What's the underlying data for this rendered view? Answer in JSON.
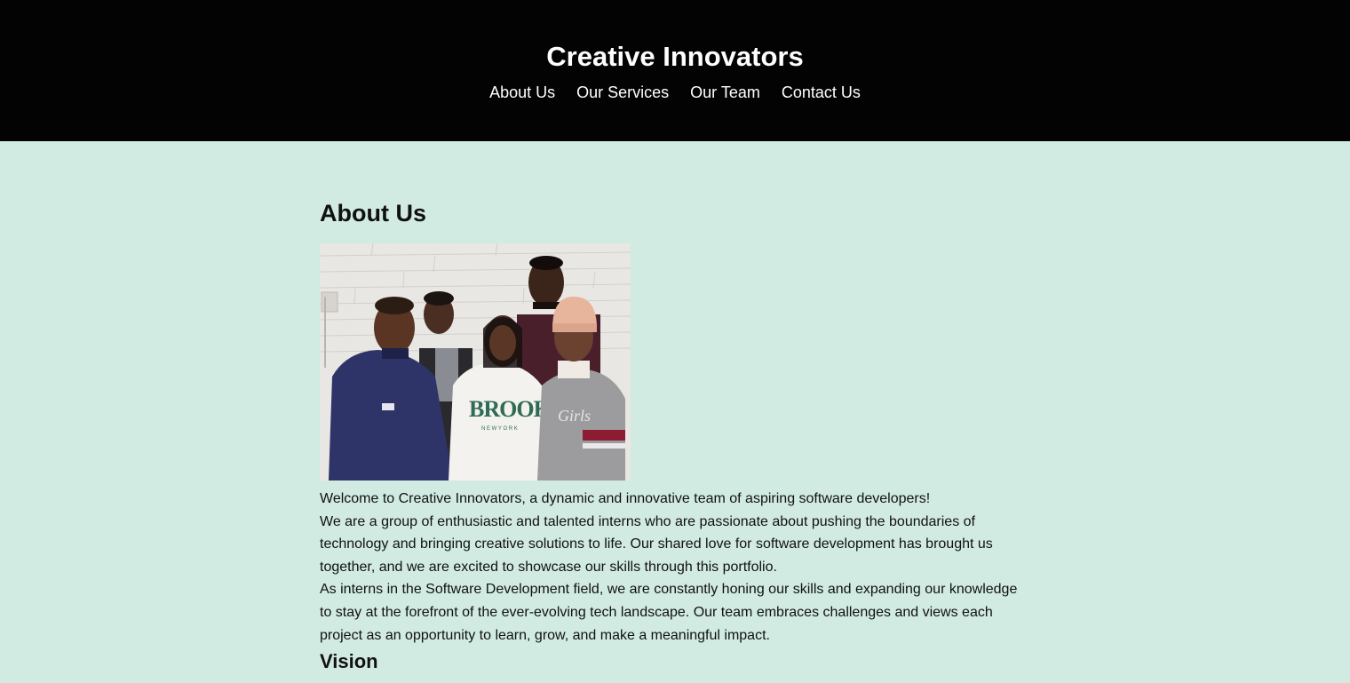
{
  "header": {
    "title": "Creative Innovators",
    "nav": [
      {
        "label": "About Us"
      },
      {
        "label": "Our Services"
      },
      {
        "label": "Our Team"
      },
      {
        "label": "Contact Us"
      }
    ]
  },
  "about": {
    "heading": "About Us",
    "photo_alt": "Team photo",
    "paragraphs": [
      "Welcome to Creative Innovators, a dynamic and innovative team of aspiring software developers!",
      "We are a group of enthusiastic and talented interns who are passionate about pushing the boundaries of technology and bringing creative solutions to life. Our shared love for software development has brought us together, and we are excited to showcase our skills through this portfolio.",
      "As interns in the Software Development field, we are constantly honing our skills and expanding our knowledge to stay at the forefront of the ever-evolving tech landscape. Our team embraces challenges and views each project as an opportunity to learn, grow, and make a meaningful impact."
    ]
  },
  "vision": {
    "heading": "Vision"
  },
  "colors": {
    "header_bg": "#030303",
    "page_bg": "#d1ebe2",
    "header_text": "#ffffff",
    "body_text": "#111111"
  }
}
